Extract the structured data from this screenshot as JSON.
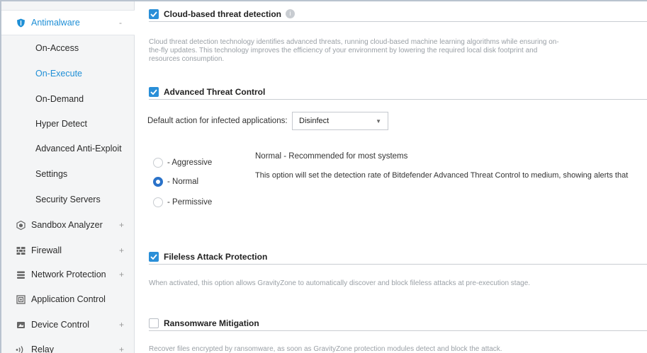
{
  "sidebar": {
    "items": [
      {
        "label": "Antimalware",
        "icon": "shield-icon",
        "toggle": "-"
      },
      {
        "label": "On-Access"
      },
      {
        "label": "On-Execute"
      },
      {
        "label": "On-Demand"
      },
      {
        "label": "Hyper Detect"
      },
      {
        "label": "Advanced Anti-Exploit"
      },
      {
        "label": "Settings"
      },
      {
        "label": "Security Servers"
      },
      {
        "label": "Sandbox Analyzer",
        "icon": "sandbox-icon",
        "toggle": "+"
      },
      {
        "label": "Firewall",
        "icon": "firewall-icon",
        "toggle": "+"
      },
      {
        "label": "Network Protection",
        "icon": "network-icon",
        "toggle": "+"
      },
      {
        "label": "Application Control",
        "icon": "app-control-icon"
      },
      {
        "label": "Device Control",
        "icon": "device-icon",
        "toggle": "+"
      },
      {
        "label": "Relay",
        "icon": "relay-icon",
        "toggle": "+"
      }
    ]
  },
  "content": {
    "cloud": {
      "title": "Cloud-based threat detection",
      "checked": true,
      "desc_lines": [
        "Cloud threat detection technology identifies advanced threats, running cloud-based machine learning algorithms while ensuring on-",
        "the-fly updates. This technology improves the efficiency of your environment by lowering the required local disk footprint and",
        "resources consumption."
      ]
    },
    "atc": {
      "title": "Advanced Threat Control",
      "checked": true,
      "default_action_label": "Default action for infected applications:",
      "default_action_value": "Disinfect",
      "levels": [
        {
          "label": "- Aggressive",
          "selected": false
        },
        {
          "label": "- Normal",
          "selected": true
        },
        {
          "label": "- Permissive",
          "selected": false
        }
      ],
      "level_title": "Normal - Recommended for most systems",
      "level_desc": "This option will set the detection rate of Bitdefender Advanced Threat Control to medium, showing alerts that"
    },
    "fileless": {
      "title": "Fileless Attack Protection",
      "checked": true,
      "desc": "When activated, this option allows GravityZone to automatically discover and block fileless attacks at pre-execution stage."
    },
    "ransomware": {
      "title": "Ransomware Mitigation",
      "checked": false,
      "desc": "Recover files encrypted by ransomware, as soon as GravityZone protection modules detect and block the attack."
    }
  },
  "colors": {
    "accent": "#1f8fd6",
    "checkbox": "#2a8fd8",
    "radio": "#2a72c9"
  }
}
